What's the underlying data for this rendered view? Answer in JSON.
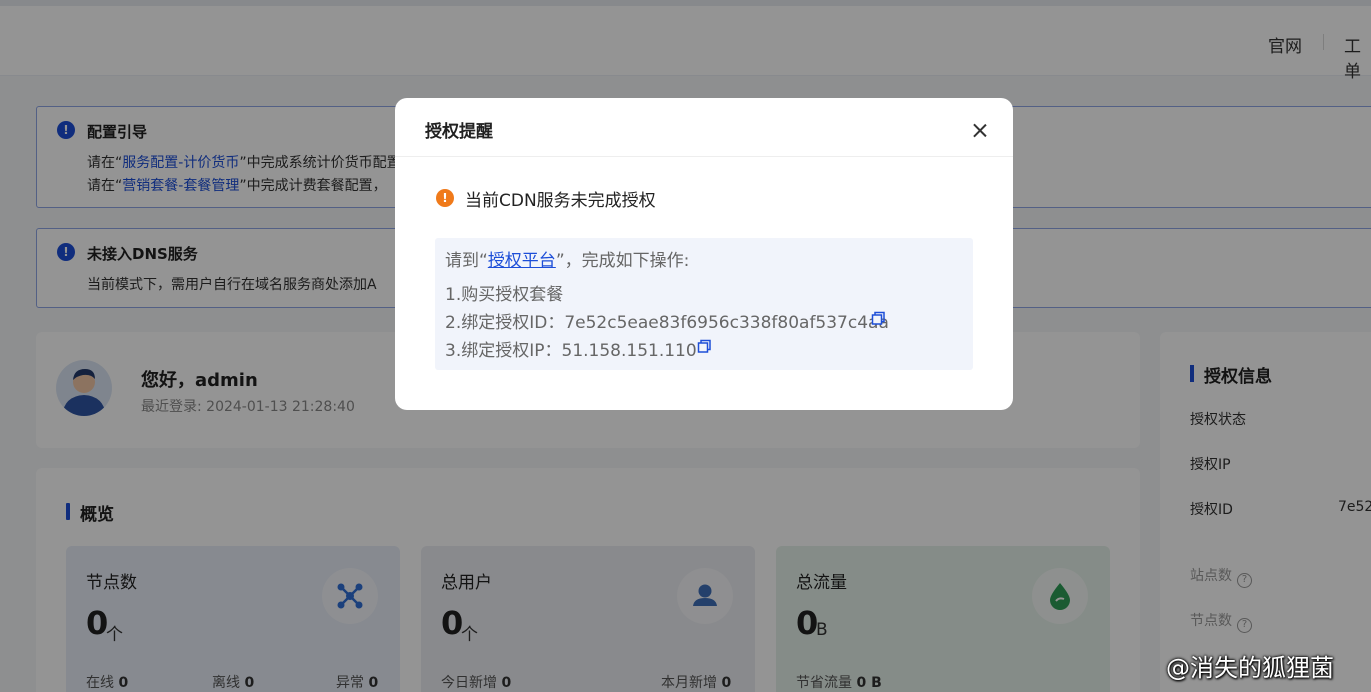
{
  "header": {
    "links": [
      "官网",
      "工单"
    ]
  },
  "alerts": {
    "config": {
      "title": "配置引导",
      "line1_prefix": "请在“",
      "line1_link": "服务配置-计价货币",
      "line1_suffix": "”中完成系统计价货币配置，",
      "line2_prefix": "请在“",
      "line2_link": "营销套餐-套餐管理",
      "line2_suffix": "”中完成计费套餐配置，"
    },
    "dns": {
      "title": "未接入DNS服务",
      "line1": "当前模式下，需用户自行在域名服务商处添加A"
    }
  },
  "profile": {
    "greeting": "您好，admin",
    "last_login": "最近登录: 2024-01-13 21:28:40"
  },
  "overview": {
    "title": "概览",
    "stats": [
      {
        "label": "节点数",
        "value": "0",
        "unit": "个",
        "icon": "network-nodes-icon",
        "mini": [
          {
            "label": "在线",
            "value": "0"
          },
          {
            "label": "离线",
            "value": "0"
          },
          {
            "label": "异常",
            "value": "0"
          }
        ]
      },
      {
        "label": "总用户",
        "value": "0",
        "unit": "个",
        "icon": "user-icon",
        "mini": [
          {
            "label": "今日新增",
            "value": "0"
          },
          {
            "label": "本月新增",
            "value": "0"
          }
        ]
      },
      {
        "label": "总流量",
        "value": "0",
        "unit": "B",
        "icon": "water-drop-icon",
        "mini": [
          {
            "label": "节省流量",
            "value": "0 B"
          }
        ]
      }
    ]
  },
  "license_info": {
    "title": "授权信息",
    "rows": [
      {
        "label": "授权状态",
        "value": ""
      },
      {
        "label": "授权IP",
        "value": ""
      },
      {
        "label": "授权ID",
        "value": "7e52"
      }
    ],
    "extra_rows": [
      "站点数",
      "节点数"
    ]
  },
  "modal": {
    "title": "授权提醒",
    "warning": "当前CDN服务未完成授权",
    "instruction_prefix": "请到“",
    "instruction_link": "授权平台",
    "instruction_suffix": "”，完成如下操作:",
    "step1": "1.购买授权套餐",
    "step2_label": "2.绑定授权ID：",
    "step2_value": "7e52c5eae83f6956c338f80af537c4aa",
    "step3_label": "3.绑定授权IP：",
    "step3_value": "51.158.151.110"
  },
  "watermark": "@消失的狐狸菌",
  "colors": {
    "accent": "#1d4ed8",
    "warning": "#f07a1a"
  }
}
